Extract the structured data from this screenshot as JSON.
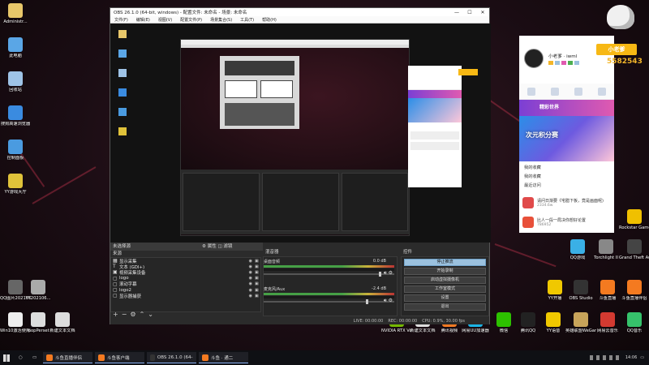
{
  "desktop_left": [
    {
      "label": "Administr...",
      "color": "#e8c76a"
    },
    {
      "label": "此电脑",
      "color": "#5aa6e6"
    },
    {
      "label": "回收站",
      "color": "#9ec3e6"
    },
    {
      "label": "搜狗高速浏览器",
      "color": "#3a8be0"
    },
    {
      "label": "控制面板",
      "color": "#4a9be0"
    },
    {
      "label": "YY游戏大厅",
      "color": "#e0c23a"
    }
  ],
  "desktop_left_bottom": [
    {
      "label": "QQ图片20210623...",
      "color": "#666"
    },
    {
      "label": "YY202106...",
      "color": "#aaa"
    },
    {
      "label": "Win10激活使用工具",
      "color": "#eee"
    },
    {
      "label": "loopPerset",
      "color": "#ddd"
    },
    {
      "label": "新建文本文档",
      "color": "#ddd"
    }
  ],
  "desktop_right": [
    {
      "label": "QQ游戏",
      "color": "#3ab0e6"
    },
    {
      "label": "Torchlight II",
      "color": "#888"
    },
    {
      "label": "Grand Theft Auto V",
      "color": "#444"
    },
    {
      "label": "Rockstar Games...",
      "color": "#f0c000"
    },
    {
      "label": "YY开播",
      "color": "#f0c800"
    },
    {
      "label": "OBS Studio",
      "color": "#333"
    },
    {
      "label": "斗鱼直播",
      "color": "#f47a20"
    },
    {
      "label": "斗鱼直播伴侣",
      "color": "#f47a20"
    },
    {
      "label": "QQ音乐",
      "color": "#36c26b"
    }
  ],
  "desktop_bottom_row": [
    {
      "label": "NVIDIA RTX Voice",
      "color": "#76b900"
    },
    {
      "label": "新建文本文档",
      "color": "#ddd"
    },
    {
      "label": "腾讯视频",
      "color": "#f57a23"
    },
    {
      "label": "网易UU加速器",
      "color": "#1bb4e6"
    },
    {
      "label": "微信",
      "color": "#2dc100"
    },
    {
      "label": "腾讯QQ",
      "color": "#222"
    },
    {
      "label": "YY语音",
      "color": "#f0c800"
    },
    {
      "label": "英雄联盟WeGame版",
      "color": "#c8a45a"
    },
    {
      "label": "网易云音乐",
      "color": "#d33a31"
    }
  ],
  "obs": {
    "title": "OBS 26.1.0 (64-bit, windows) - 配置文件: 未命名 - 场景: 未命名",
    "menu": [
      "文件(F)",
      "编辑(E)",
      "视图(V)",
      "配置文件(P)",
      "场景集合(S)",
      "工具(T)",
      "帮助(H)"
    ],
    "scene_dock_label": "来源",
    "sources_header": "未选择源",
    "props_label": "属性",
    "filters_label": "滤镜",
    "sources": [
      {
        "icon": "▦",
        "label": "显示采集"
      },
      {
        "icon": "T",
        "label": "文本 (GDI+)"
      },
      {
        "icon": "▣",
        "label": "视频采集设备"
      },
      {
        "icon": "▢",
        "label": "logo"
      },
      {
        "icon": "▢",
        "label": "滚动字幕"
      },
      {
        "icon": "▢",
        "label": "logo2"
      },
      {
        "icon": "▢",
        "label": "显示器捕获"
      }
    ],
    "mixer_label": "混音器",
    "mixer": [
      {
        "name": "桌面音频",
        "db": "0.0 dB"
      },
      {
        "name": "麦克风/Aux",
        "db": "-2.4 dB"
      }
    ],
    "controls_label": "控件",
    "controls": [
      "停止推流",
      "开始录制",
      "启动虚拟摄像机",
      "工作室模式",
      "设置",
      "退出"
    ],
    "status": {
      "live": "LIVE: 00:00:00",
      "rec": "REC: 00:00:00",
      "cpu": "CPU: 0.9%, 30.00 fps"
    }
  },
  "app": {
    "username": "小老爹 · iwml",
    "score_badge": "小老爹",
    "score": "5582543",
    "promo": "精彩世界",
    "promo_sub": "次元积分赛",
    "list": [
      "我的收藏",
      "我的收藏",
      "最近访问"
    ],
    "games": [
      {
        "title": "请问日渐要《宅腊下板，竟是画面呢)",
        "sub": "2334.6w",
        "color": "#e04a4a"
      },
      {
        "title": "比人一段一局决你想好论置",
        "sub": "786952",
        "color": "#e8503a"
      }
    ]
  },
  "taskbar": {
    "items": [
      {
        "label": "斗鱼直播伴侣",
        "color": "#f47a20"
      },
      {
        "label": "斗鱼客户端",
        "color": "#f47a20"
      },
      {
        "label": "OBS 26.1.0 (64-bit, ...",
        "color": "#333"
      },
      {
        "label": "斗鱼 · 通二",
        "color": "#f47a20"
      }
    ],
    "time": "14:06"
  }
}
